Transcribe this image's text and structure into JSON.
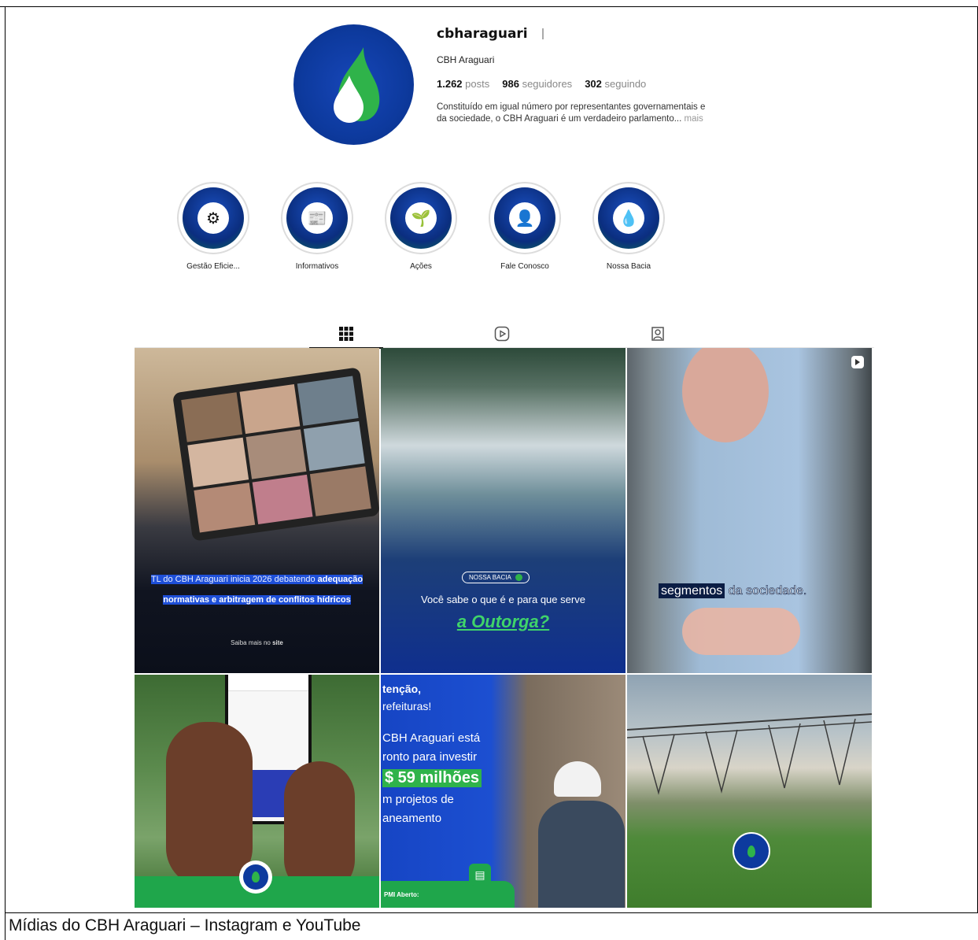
{
  "profile": {
    "username": "cbharaguari",
    "full_name": "CBH Araguari",
    "posts_count": "1.262",
    "posts_label": "posts",
    "followers_count": "986",
    "followers_label": "seguidores",
    "following_count": "302",
    "following_label": "seguindo",
    "bio": "Constituído em igual número por representantes governamentais e da sociedade, o CBH Araguari é um verdadeiro parlamento...",
    "bio_more": "mais"
  },
  "highlights": [
    {
      "label": "Gestão Eficie...",
      "icon": "gear-icon"
    },
    {
      "label": "Informativos",
      "icon": "document-icon"
    },
    {
      "label": "Ações",
      "icon": "plant-icon"
    },
    {
      "label": "Fale Conosco",
      "icon": "person-icon"
    },
    {
      "label": "Nossa Bacia",
      "icon": "globe-water-icon"
    }
  ],
  "tabs": [
    {
      "name": "posts",
      "icon": "grid-icon",
      "active": true
    },
    {
      "name": "reels",
      "icon": "reels-icon",
      "active": false
    },
    {
      "name": "tagged",
      "icon": "tagged-icon",
      "active": false
    }
  ],
  "posts": [
    {
      "id": "post-1",
      "line1_pre": "TL do CBH Araguari inicia 2026 debatendo ",
      "line1_bold": "adequação",
      "line2": "normativas e arbitragem de conflitos hídricos",
      "footer_pre": "Saiba mais no ",
      "footer_bold": "site"
    },
    {
      "id": "post-2",
      "badge": "NOSSA BACIA",
      "line1": "Você sabe o que é e para que serve",
      "line2": "a Outorga?"
    },
    {
      "id": "post-3",
      "caption_highlight": "segmentos",
      "caption_rest": "da sociedade.",
      "video_icon": "reel-icon"
    },
    {
      "id": "post-4"
    },
    {
      "id": "post-5",
      "l1": "tenção,",
      "l2": "refeituras!",
      "l3": "CBH Araguari está",
      "l4": "ronto para investir",
      "l5": "$ 59 milhões",
      "l6": "m projetos de",
      "l7": "aneamento",
      "l8": "PMI Aberto:"
    },
    {
      "id": "post-6"
    }
  ],
  "caption": "Mídias do CBH Araguari – Instagram e YouTube",
  "colors": {
    "brand_blue": "#0d3a9e",
    "brand_green": "#18a84a",
    "grid_border": "#ffffff"
  }
}
